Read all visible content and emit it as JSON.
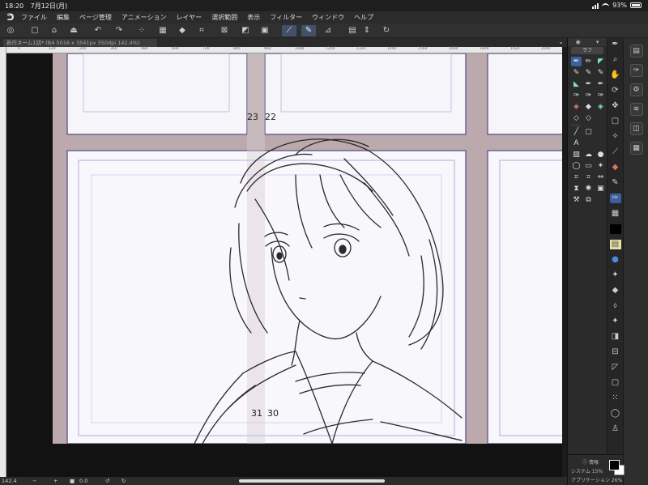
{
  "status_bar": {
    "time": "18:20",
    "date": "7月12日(月)",
    "battery": "93%"
  },
  "menu": {
    "items": [
      "ファイル",
      "編集",
      "ページ管理",
      "アニメーション",
      "レイヤー",
      "選択範囲",
      "表示",
      "フィルター",
      "ウィンドウ",
      "ヘルプ"
    ]
  },
  "tab": {
    "title": "新作ネーム1話* (B4 5016 x 3541px 350dpi 142.4%)"
  },
  "ruler_ticks": [
    "0",
    "120",
    "240",
    "360",
    "480",
    "600",
    "720",
    "840",
    "960",
    "1080",
    "1200",
    "1320",
    "1440",
    "1560",
    "1680",
    "1800",
    "1920",
    "2040"
  ],
  "canvas": {
    "panel_numbers": [
      "23",
      "22",
      "31",
      "30"
    ]
  },
  "bottom_bar": {
    "zoom": "142.4",
    "angle": "0.0"
  },
  "tool_panel": {
    "subtool_label": "ラフ"
  },
  "panel_bottom": {
    "info_label": "情報",
    "system_label": "システム",
    "system_value": "15%",
    "app_label": "アプリケーション",
    "app_value": "26%"
  },
  "colors": {
    "paper": "#bba9ad",
    "frame_line": "#6a6490",
    "accent": "#3b5fa0"
  }
}
